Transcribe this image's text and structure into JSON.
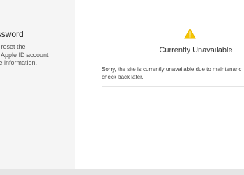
{
  "sidebar": {
    "title": "assword",
    "description_lines": [
      "or reset the",
      "ur Apple ID account",
      "me information."
    ]
  },
  "main": {
    "icon": "warning-icon",
    "title": "Currently Unavailable",
    "message_lines": [
      "Sorry, the site is currently unavailable due to maintenanc",
      "check back later."
    ]
  },
  "colors": {
    "warning": "#f5c400",
    "background": "#ffffff",
    "sidebar_background": "#f5f5f5"
  }
}
